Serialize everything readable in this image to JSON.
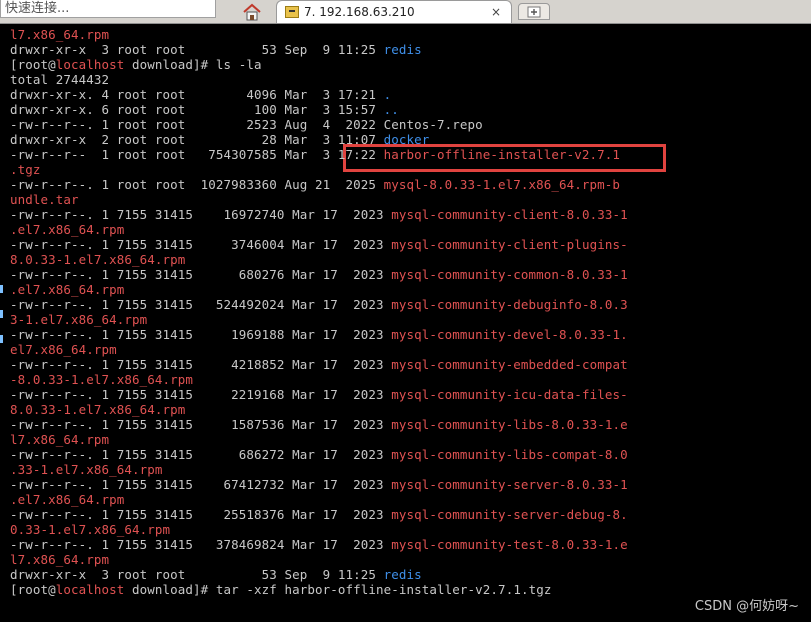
{
  "toolbar": {
    "quick_connect_placeholder": "快速连接...",
    "session_tab_title": "7. 192.168.63.210",
    "close_glyph": "×"
  },
  "terminal": {
    "lines": [
      [
        {
          "t": "l7.x86_64.rpm",
          "c": "red"
        }
      ],
      [
        {
          "t": "drwxr-xr-x  3 root root          53 Sep  9 11:25 ",
          "c": "plain"
        },
        {
          "t": "redis",
          "c": "blue"
        }
      ],
      [
        {
          "t": "[root@",
          "c": "plain"
        },
        {
          "t": "localhost",
          "c": "red"
        },
        {
          "t": " download]# ls -la",
          "c": "plain"
        }
      ],
      [
        {
          "t": "total 2744432",
          "c": "plain"
        }
      ],
      [
        {
          "t": "drwxr-xr-x. 4 root root        4096 Mar  3 17:21 ",
          "c": "plain"
        },
        {
          "t": ".",
          "c": "blue"
        }
      ],
      [
        {
          "t": "drwxr-xr-x. 6 root root         100 Mar  3 15:57 ",
          "c": "plain"
        },
        {
          "t": "..",
          "c": "blue"
        }
      ],
      [
        {
          "t": "-rw-r--r--. 1 root root        2523 Aug  4  2022 Centos-7.repo",
          "c": "plain"
        }
      ],
      [
        {
          "t": "drwxr-xr-x  2 root root          28 Mar  3 11:07 ",
          "c": "plain"
        },
        {
          "t": "docker",
          "c": "blue"
        }
      ],
      [
        {
          "t": "-rw-r--r--  1 root root   754307585 Mar  3 17:22 ",
          "c": "plain"
        },
        {
          "t": "harbor-offline-installer-v2.7.1",
          "c": "red"
        }
      ],
      [
        {
          "t": ".tgz",
          "c": "red"
        }
      ],
      [
        {
          "t": "-rw-r--r--. 1 root root  1027983360 Aug 21  2025 ",
          "c": "plain"
        },
        {
          "t": "mysql-8.0.33-1.el7.x86_64.rpm-b",
          "c": "red"
        }
      ],
      [
        {
          "t": "undle.tar",
          "c": "red"
        }
      ],
      [
        {
          "t": "-rw-r--r--. 1 7155 31415    16972740 Mar 17  2023 ",
          "c": "plain"
        },
        {
          "t": "mysql-community-client-8.0.33-1",
          "c": "red"
        }
      ],
      [
        {
          "t": ".el7.x86_64.rpm",
          "c": "red"
        }
      ],
      [
        {
          "t": "-rw-r--r--. 1 7155 31415     3746004 Mar 17  2023 ",
          "c": "plain"
        },
        {
          "t": "mysql-community-client-plugins-",
          "c": "red"
        }
      ],
      [
        {
          "t": "8.0.33-1.el7.x86_64.rpm",
          "c": "red"
        }
      ],
      [
        {
          "t": "-rw-r--r--. 1 7155 31415      680276 Mar 17  2023 ",
          "c": "plain"
        },
        {
          "t": "mysql-community-common-8.0.33-1",
          "c": "red"
        }
      ],
      [
        {
          "t": ".el7.x86_64.rpm",
          "c": "red"
        }
      ],
      [
        {
          "t": "-rw-r--r--. 1 7155 31415   524492024 Mar 17  2023 ",
          "c": "plain"
        },
        {
          "t": "mysql-community-debuginfo-8.0.3",
          "c": "red"
        }
      ],
      [
        {
          "t": "3-1.el7.x86_64.rpm",
          "c": "red"
        }
      ],
      [
        {
          "t": "-rw-r--r--. 1 7155 31415     1969188 Mar 17  2023 ",
          "c": "plain"
        },
        {
          "t": "mysql-community-devel-8.0.33-1.",
          "c": "red"
        }
      ],
      [
        {
          "t": "el7.x86_64.rpm",
          "c": "red"
        }
      ],
      [
        {
          "t": "-rw-r--r--. 1 7155 31415     4218852 Mar 17  2023 ",
          "c": "plain"
        },
        {
          "t": "mysql-community-embedded-compat",
          "c": "red"
        }
      ],
      [
        {
          "t": "-8.0.33-1.el7.x86_64.rpm",
          "c": "red"
        }
      ],
      [
        {
          "t": "-rw-r--r--. 1 7155 31415     2219168 Mar 17  2023 ",
          "c": "plain"
        },
        {
          "t": "mysql-community-icu-data-files-",
          "c": "red"
        }
      ],
      [
        {
          "t": "8.0.33-1.el7.x86_64.rpm",
          "c": "red"
        }
      ],
      [
        {
          "t": "-rw-r--r--. 1 7155 31415     1587536 Mar 17  2023 ",
          "c": "plain"
        },
        {
          "t": "mysql-community-libs-8.0.33-1.e",
          "c": "red"
        }
      ],
      [
        {
          "t": "l7.x86_64.rpm",
          "c": "red"
        }
      ],
      [
        {
          "t": "-rw-r--r--. 1 7155 31415      686272 Mar 17  2023 ",
          "c": "plain"
        },
        {
          "t": "mysql-community-libs-compat-8.0",
          "c": "red"
        }
      ],
      [
        {
          "t": ".33-1.el7.x86_64.rpm",
          "c": "red"
        }
      ],
      [
        {
          "t": "-rw-r--r--. 1 7155 31415    67412732 Mar 17  2023 ",
          "c": "plain"
        },
        {
          "t": "mysql-community-server-8.0.33-1",
          "c": "red"
        }
      ],
      [
        {
          "t": ".el7.x86_64.rpm",
          "c": "red"
        }
      ],
      [
        {
          "t": "-rw-r--r--. 1 7155 31415    25518376 Mar 17  2023 ",
          "c": "plain"
        },
        {
          "t": "mysql-community-server-debug-8.",
          "c": "red"
        }
      ],
      [
        {
          "t": "0.33-1.el7.x86_64.rpm",
          "c": "red"
        }
      ],
      [
        {
          "t": "-rw-r--r--. 1 7155 31415   378469824 Mar 17  2023 ",
          "c": "plain"
        },
        {
          "t": "mysql-community-test-8.0.33-1.e",
          "c": "red"
        }
      ],
      [
        {
          "t": "l7.x86_64.rpm",
          "c": "red"
        }
      ],
      [
        {
          "t": "drwxr-xr-x  3 root root          53 Sep  9 11:25 ",
          "c": "plain"
        },
        {
          "t": "redis",
          "c": "blue"
        }
      ],
      [
        {
          "t": "[root@",
          "c": "plain"
        },
        {
          "t": "localhost",
          "c": "red"
        },
        {
          "t": " download]# tar -xzf harbor-offline-installer-v2.7.1.tgz",
          "c": "plain"
        }
      ]
    ]
  },
  "watermark": "CSDN @何妨呀~",
  "colors": {
    "background": "#000000",
    "text": "#c8c8c8",
    "archive_red": "#e05252",
    "directory_blue": "#3f8fe8",
    "highlight_box": "#e0433f"
  }
}
